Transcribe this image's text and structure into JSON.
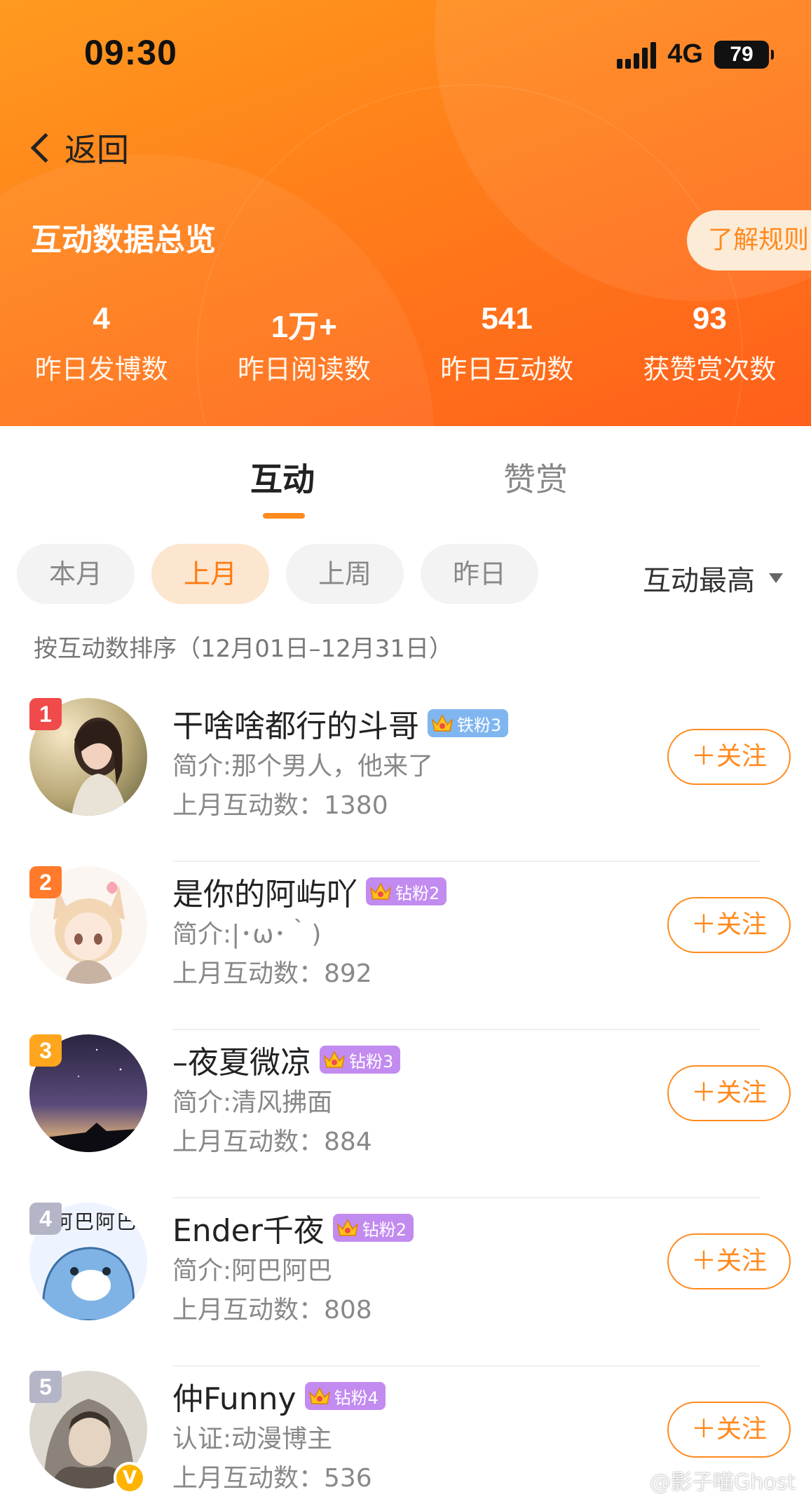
{
  "status": {
    "time": "09:30",
    "network": "4G",
    "battery": "79"
  },
  "nav": {
    "back_label": "返回"
  },
  "header": {
    "title": "互动数据总览",
    "rules_button": "了解规则"
  },
  "stats": [
    {
      "value": "4",
      "label": "昨日发博数"
    },
    {
      "value": "1万+",
      "label": "昨日阅读数"
    },
    {
      "value": "541",
      "label": "昨日互动数"
    },
    {
      "value": "93",
      "label": "获赞赏次数"
    }
  ],
  "tabs": {
    "active": "互动",
    "inactive": "赞赏"
  },
  "filters": [
    "本月",
    "上月",
    "上周",
    "昨日"
  ],
  "sort_label": "互动最高",
  "range_text": "按互动数排序（12月01日–12月31日）",
  "follow_label": "＋关注",
  "colors": {
    "accent": "#ff8a1e",
    "rank1": "#f04a4a",
    "rank2": "#ff7a2a",
    "rank3": "#ffa51e",
    "rank_other": "#b5b5c8"
  },
  "users": [
    {
      "rank": "1",
      "name": "干啥啥都行的斗哥",
      "badge": "铁粉3",
      "desc": "简介:那个男人，他来了",
      "count": "上月互动数：1380"
    },
    {
      "rank": "2",
      "name": "是你的阿屿吖",
      "badge": "钻粉2",
      "desc": "简介:|･ω･｀)",
      "count": "上月互动数：892"
    },
    {
      "rank": "3",
      "name": "–夜夏微凉",
      "badge": "钻粉3",
      "desc": "简介:清风拂面",
      "count": "上月互动数：884"
    },
    {
      "rank": "4",
      "name": "Ender千夜",
      "badge": "钻粉2",
      "desc": "简介:阿巴阿巴",
      "count": "上月互动数：808",
      "avatar_text": "阿巴阿巴"
    },
    {
      "rank": "5",
      "name": "仲Funny",
      "badge": "钻粉4",
      "desc": "认证:动漫博主",
      "count": "上月互动数：536",
      "verified": "V"
    }
  ],
  "watermark": "@影子喵Ghost"
}
